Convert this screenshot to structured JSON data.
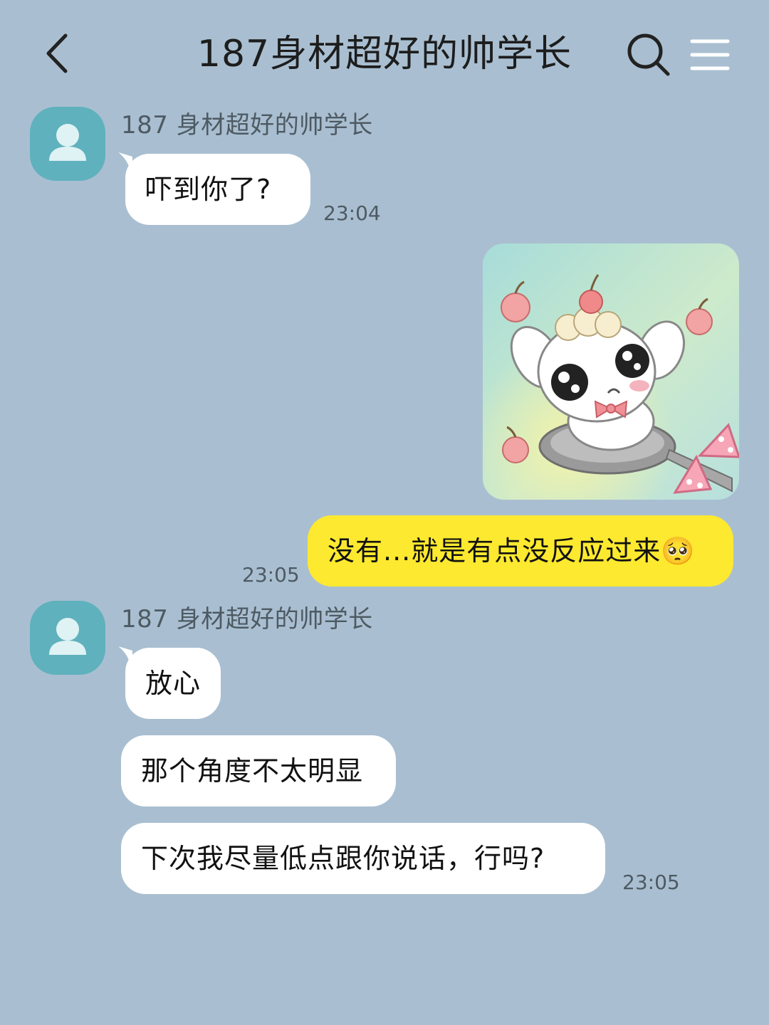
{
  "header": {
    "title": "187身材超好的帅学长",
    "back_icon": "chevron-left-icon",
    "search_icon": "search-icon",
    "menu_icon": "menu-icon"
  },
  "colors": {
    "background": "#a9bfd1",
    "incoming_bubble": "#ffffff",
    "outgoing_bubble": "#fde92f",
    "avatar": "#5fb1bd"
  },
  "messages": {
    "group1": {
      "sender": "187 身材超好的帅学长",
      "avatar_icon": "user-icon",
      "text": "吓到你了?",
      "time": "23:04"
    },
    "sticker": {
      "description_icon": "sticker-image",
      "from": "me"
    },
    "mine1": {
      "text": "没有...就是有点没反应过来🥺",
      "time": "23:05"
    },
    "group2": {
      "sender": "187 身材超好的帅学长",
      "avatar_icon": "user-icon",
      "texts": [
        "放心",
        "那个角度不太明显",
        "下次我尽量低点跟你说话，行吗?"
      ],
      "time": "23:05"
    }
  }
}
